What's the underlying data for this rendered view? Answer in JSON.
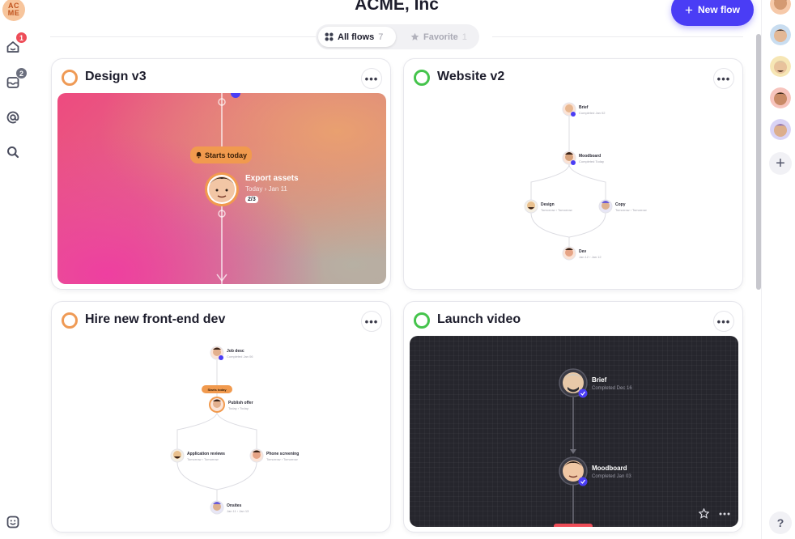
{
  "header": {
    "workspace_logo": "ACME",
    "page_title": "ACME, Inc",
    "new_flow_label": "New flow",
    "new_flow_plus": "+"
  },
  "sidebar": {
    "items": [
      {
        "name": "home",
        "icon": "home-icon",
        "badge": "1",
        "badge_color": "#ee4d58"
      },
      {
        "name": "inbox",
        "icon": "inbox-icon",
        "badge": "2",
        "badge_color": "#6b6f7e"
      },
      {
        "name": "mentions",
        "icon": "at-icon"
      },
      {
        "name": "search",
        "icon": "search-icon"
      }
    ],
    "bottom_icon": "smiley-icon"
  },
  "tabs": [
    {
      "label": "All flows",
      "count": "7",
      "active": true,
      "icon": "grid-icon"
    },
    {
      "label": "Favorite",
      "count": "1",
      "active": false,
      "icon": "star-icon"
    }
  ],
  "right_rail": {
    "avatars": [
      "member-avatar-1",
      "member-avatar-2",
      "member-avatar-3",
      "member-avatar-4",
      "member-avatar-5"
    ],
    "add_label": "+",
    "help_label": "?"
  },
  "cards": [
    {
      "title": "Design v3",
      "status_color": "#ef9a55",
      "more_label": "•••",
      "preview": {
        "pill": "Starts today",
        "step_title": "Export assets",
        "step_date": "Today › Jan 11",
        "step_count": "2/3"
      }
    },
    {
      "title": "Website v2",
      "status_color": "#45c44c",
      "more_label": "•••",
      "preview": {
        "nodes": [
          {
            "label": "Brief",
            "sub": "Completed Jan 02"
          },
          {
            "label": "Moodboard",
            "sub": "Completed Today"
          },
          {
            "label": "Design",
            "sub": "Tomorrow › Tomorrow"
          },
          {
            "label": "Copy",
            "sub": "Tomorrow › Tomorrow"
          },
          {
            "label": "Dev",
            "sub": "Jan 12 › Jan 12"
          }
        ]
      }
    },
    {
      "title": "Hire new front-end dev",
      "status_color": "#ef9a55",
      "more_label": "•••",
      "preview": {
        "pill": "Starts today",
        "nodes": [
          {
            "label": "Job desc",
            "sub": "Completed Jan 06"
          },
          {
            "label": "Publish offer",
            "sub": "Today › Today"
          },
          {
            "label": "Application reviews",
            "sub": "Tomorrow › Tomorrow"
          },
          {
            "label": "Phone screening",
            "sub": "Tomorrow › Tomorrow"
          },
          {
            "label": "Onsites",
            "sub": "Jan 11 › Jan 13"
          }
        ]
      }
    },
    {
      "title": "Launch video",
      "status_color": "#45c44c",
      "more_label": "•••",
      "preview": {
        "nodes": [
          {
            "label": "Brief",
            "sub": "Completed Dec 16"
          },
          {
            "label": "Moodboard",
            "sub": "Completed Jan 03"
          }
        ]
      }
    }
  ]
}
